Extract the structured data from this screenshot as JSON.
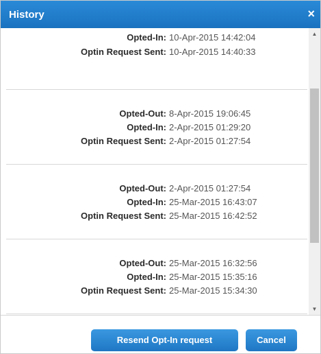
{
  "dialog": {
    "title": "History",
    "close_glyph": "×"
  },
  "entries": [
    {
      "rows": [
        {
          "label": "",
          "value": ""
        },
        {
          "label": "Opted-In:",
          "value": "10-Apr-2015 14:42:04"
        },
        {
          "label": "Optin Request Sent:",
          "value": "10-Apr-2015 14:40:33"
        }
      ]
    },
    {
      "rows": [
        {
          "label": "Opted-Out:",
          "value": "8-Apr-2015 19:06:45"
        },
        {
          "label": "Opted-In:",
          "value": "2-Apr-2015 01:29:20"
        },
        {
          "label": "Optin Request Sent:",
          "value": "2-Apr-2015 01:27:54"
        }
      ]
    },
    {
      "rows": [
        {
          "label": "Opted-Out:",
          "value": "2-Apr-2015 01:27:54"
        },
        {
          "label": "Opted-In:",
          "value": "25-Mar-2015 16:43:07"
        },
        {
          "label": "Optin Request Sent:",
          "value": "25-Mar-2015 16:42:52"
        }
      ]
    },
    {
      "rows": [
        {
          "label": "Opted-Out:",
          "value": "25-Mar-2015 16:32:56"
        },
        {
          "label": "Opted-In:",
          "value": "25-Mar-2015 15:35:16"
        },
        {
          "label": "Optin Request Sent:",
          "value": "25-Mar-2015 15:34:30"
        }
      ]
    }
  ],
  "scrollbar": {
    "up_glyph": "▲",
    "down_glyph": "▼"
  },
  "footer": {
    "resend_label": "Resend Opt-In request",
    "cancel_label": "Cancel"
  },
  "colors": {
    "title_bar": "#1f7ccc",
    "button": "#2b86d2",
    "label_text": "#2b2b2b",
    "value_text": "#555555"
  }
}
